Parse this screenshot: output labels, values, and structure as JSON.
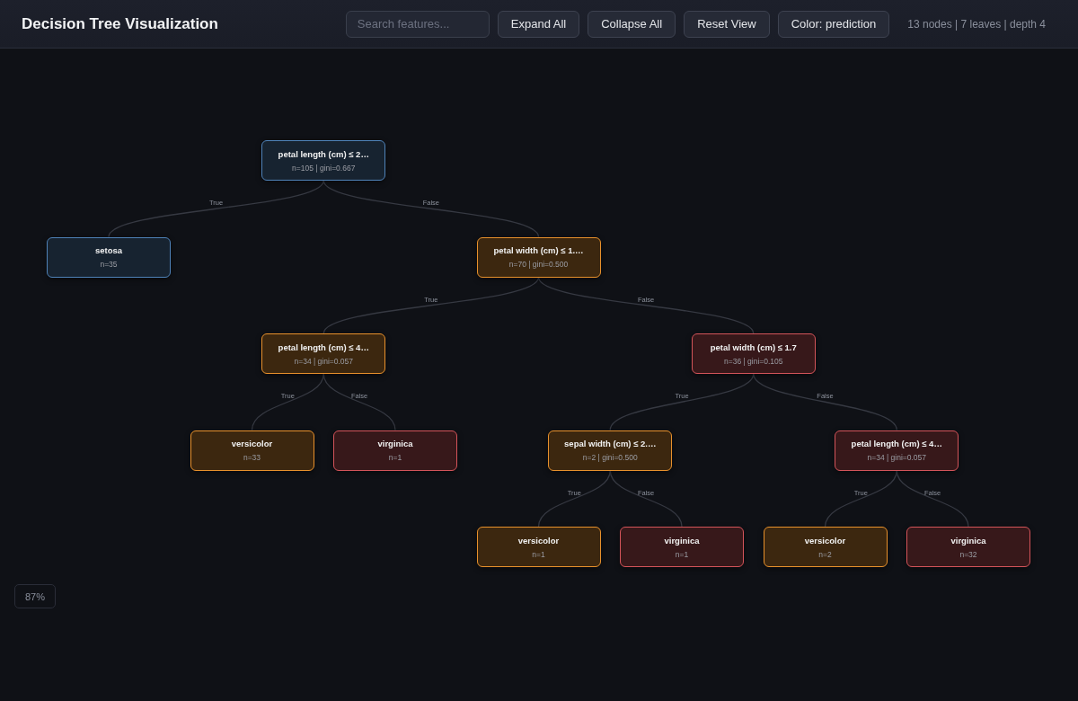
{
  "header": {
    "title": "Decision Tree Visualization",
    "search": {
      "placeholder": "Search features..."
    },
    "buttons": [
      "Expand All",
      "Collapse All",
      "Reset View",
      "Color: prediction"
    ],
    "stats": "13 nodes | 7 leaves | depth 4"
  },
  "tree": {
    "root": {
      "title": "petal length (cm) ≤ 2…",
      "stats": "n=105 | gini=0.667",
      "color": "#4f82b8",
      "children": [
        {
          "edge_label": "True",
          "title": "setosa",
          "stats": "n=35",
          "color": "#4f82b8"
        },
        {
          "edge_label": "False",
          "title": "petal width (cm) ≤ 1.…",
          "stats": "n=70 | gini=0.500",
          "color": "#e8912c",
          "children": [
            {
              "edge_label": "True",
              "title": "petal length (cm) ≤ 4…",
              "stats": "n=34 | gini=0.057",
              "color": "#e8912c",
              "children": [
                {
                  "edge_label": "True",
                  "title": "versicolor",
                  "stats": "n=33",
                  "color": "#e8912c"
                },
                {
                  "edge_label": "False",
                  "title": "virginica",
                  "stats": "n=1",
                  "color": "#d4545a"
                }
              ]
            },
            {
              "edge_label": "False",
              "title": "petal width (cm) ≤ 1.7",
              "stats": "n=36 | gini=0.105",
              "color": "#d4545a",
              "children": [
                {
                  "edge_label": "True",
                  "title": "sepal width (cm) ≤ 2.…",
                  "stats": "n=2 | gini=0.500",
                  "color": "#e8912c",
                  "children": [
                    {
                      "edge_label": "True",
                      "title": "versicolor",
                      "stats": "n=1",
                      "color": "#e8912c"
                    },
                    {
                      "edge_label": "False",
                      "title": "virginica",
                      "stats": "n=1",
                      "color": "#d4545a"
                    }
                  ]
                },
                {
                  "edge_label": "False",
                  "title": "petal length (cm) ≤ 4…",
                  "stats": "n=34 | gini=0.057",
                  "color": "#d4545a",
                  "children": [
                    {
                      "edge_label": "True",
                      "title": "versicolor",
                      "stats": "n=2",
                      "color": "#e8912c"
                    },
                    {
                      "edge_label": "False",
                      "title": "virginica",
                      "stats": "n=32",
                      "color": "#d4545a"
                    }
                  ]
                }
              ]
            }
          ]
        }
      ]
    }
  },
  "zoom_level": "87%"
}
